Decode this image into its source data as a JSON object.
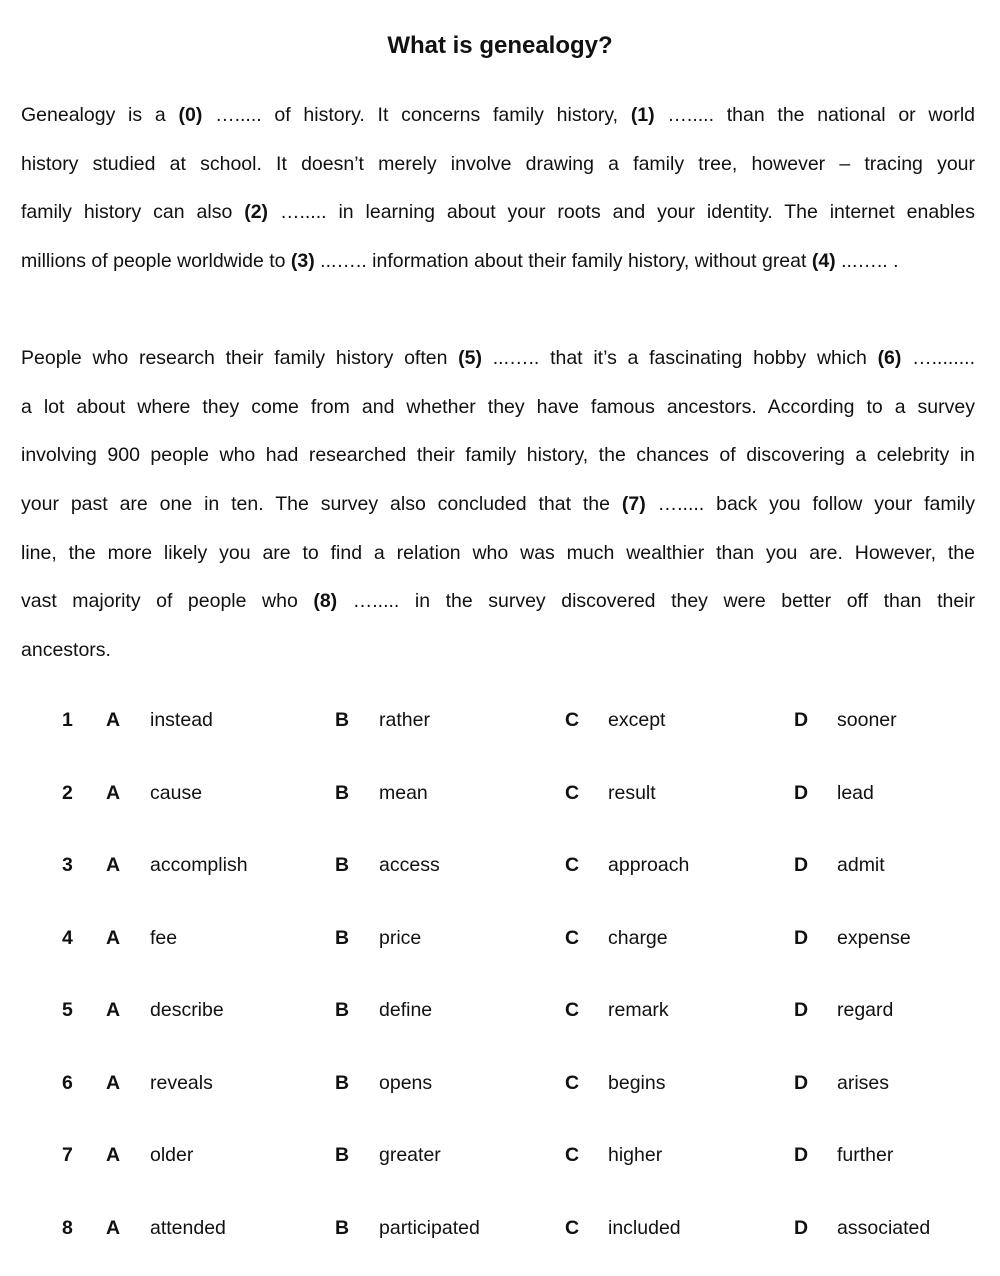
{
  "title": "What is genealogy?",
  "paragraph1": [
    [
      {
        "t": "Genealogy is a "
      },
      {
        "b": "(0)"
      },
      {
        "t": " …..... of history.  It concerns family history, "
      },
      {
        "b": "(1)"
      },
      {
        "t": " …..... than the national or world"
      }
    ],
    [
      {
        "t": "history studied at school.  It doesn’t merely involve drawing a family tree, however – tracing your"
      }
    ],
    [
      {
        "t": "family history can also "
      },
      {
        "b": "(2)"
      },
      {
        "t": " …..... in learning about your roots and your identity.  The internet enables"
      }
    ],
    [
      {
        "t": "millions of people worldwide to "
      },
      {
        "b": "(3)"
      },
      {
        "t": " ...….. information about their family history, without great "
      },
      {
        "b": "(4)"
      },
      {
        "t": " ...….. ."
      }
    ]
  ],
  "paragraph2": [
    [
      {
        "t": "People who research their family history often "
      },
      {
        "b": "(5)"
      },
      {
        "t": " ...….. that it’s a fascinating hobby which "
      },
      {
        "b": "(6)"
      },
      {
        "t": " …........"
      }
    ],
    [
      {
        "t": "a lot about where they come from and whether they have famous ancestors.  According to a survey"
      }
    ],
    [
      {
        "t": "involving 900 people who had researched their family history, the chances of discovering a celebrity in"
      }
    ],
    [
      {
        "t": "your past are one in ten.  The survey also concluded that the "
      },
      {
        "b": "(7)"
      },
      {
        "t": " …..... back you follow your family"
      }
    ],
    [
      {
        "t": "line, the more likely you are to find a relation who was much wealthier than you are.  However, the"
      }
    ],
    [
      {
        "t": "vast majority of people who "
      },
      {
        "b": "(8)"
      },
      {
        "t": " …..... in the survey discovered they were better off than their"
      }
    ],
    [
      {
        "t": "ancestors."
      }
    ]
  ],
  "questions": [
    {
      "num": "1",
      "A": "instead",
      "B": "rather",
      "C": "except",
      "D": "sooner"
    },
    {
      "num": "2",
      "A": "cause",
      "B": "mean",
      "C": "result",
      "D": "lead"
    },
    {
      "num": "3",
      "A": "accomplish",
      "B": "access",
      "C": "approach",
      "D": "admit"
    },
    {
      "num": "4",
      "A": "fee",
      "B": "price",
      "C": "charge",
      "D": "expense"
    },
    {
      "num": "5",
      "A": "describe",
      "B": "define",
      "C": "remark",
      "D": "regard"
    },
    {
      "num": "6",
      "A": "reveals",
      "B": "opens",
      "C": "begins",
      "D": "arises"
    },
    {
      "num": "7",
      "A": "older",
      "B": "greater",
      "C": "higher",
      "D": "further"
    },
    {
      "num": "8",
      "A": "attended",
      "B": "participated",
      "C": "included",
      "D": "associated"
    }
  ],
  "letters": {
    "A": "A",
    "B": "B",
    "C": "C",
    "D": "D"
  }
}
